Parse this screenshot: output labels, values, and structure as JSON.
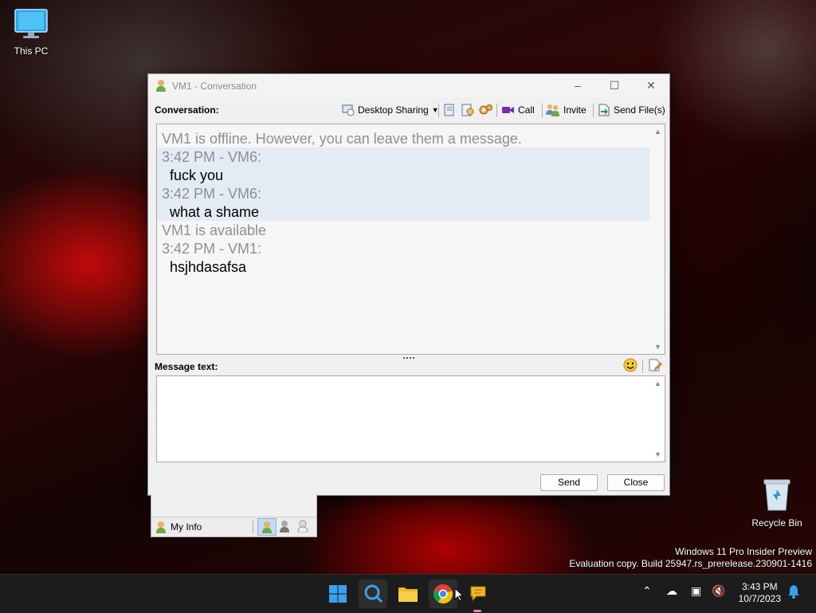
{
  "desktop": {
    "this_pc": "This PC",
    "recycle_bin": "Recycle Bin",
    "watermark_line1": "Windows 11 Pro Insider Preview",
    "watermark_line2": "Evaluation copy. Build 25947.rs_prerelease.230901-1416"
  },
  "window": {
    "title": "VM1 - Conversation",
    "conversation_label": "Conversation:",
    "toolbar": {
      "desktop_sharing": "Desktop Sharing",
      "call": "Call",
      "invite": "Invite",
      "send_files": "Send File(s)"
    },
    "messages": [
      {
        "text": "VM1 is offline. However, you can leave them a message.",
        "kind": "status"
      },
      {
        "text": "3:42 PM - VM6:",
        "kind": "header"
      },
      {
        "text": "fuck you",
        "kind": "body"
      },
      {
        "text": "3:42 PM - VM6:",
        "kind": "header"
      },
      {
        "text": "what a shame",
        "kind": "body"
      },
      {
        "text": "VM1 is available",
        "kind": "status"
      },
      {
        "text": "3:42 PM - VM1:",
        "kind": "header"
      },
      {
        "text": "hsjhdasafsa",
        "kind": "body"
      }
    ],
    "message_text_label": "Message text:",
    "message_input_value": "",
    "send_label": "Send",
    "close_label": "Close"
  },
  "info_panel": {
    "my_info": "My Info"
  },
  "taskbar": {
    "time": "3:43 PM",
    "date": "10/7/2023"
  }
}
